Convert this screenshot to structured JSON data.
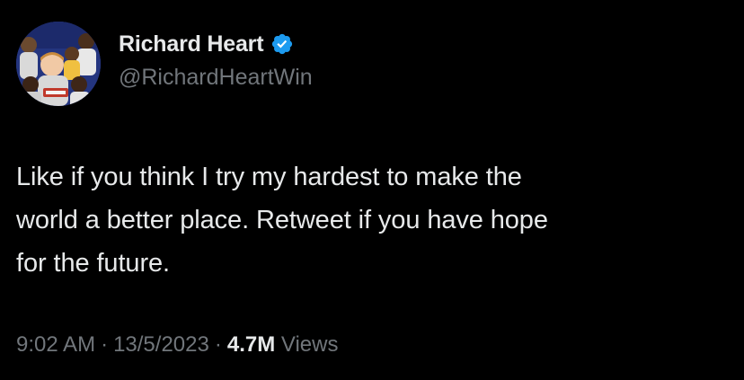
{
  "author": {
    "display_name": "Richard Heart",
    "handle": "@RichardHeartWin",
    "verified_badge_icon": "verified-badge-icon",
    "verified_color": "#1d9bf0",
    "avatar_icon": "profile-photo"
  },
  "tweet": {
    "lines": [
      "Like if you think I try my hardest to make the",
      "world a better place. Retweet if you have hope",
      "for the future."
    ]
  },
  "meta": {
    "time": "9:02 AM",
    "separator": "·",
    "date": "13/5/2023",
    "views_count": "4.7M",
    "views_label": "Views"
  },
  "colors": {
    "background": "#000000",
    "primary_text": "#e7e9ea",
    "secondary_text": "#71767b"
  }
}
